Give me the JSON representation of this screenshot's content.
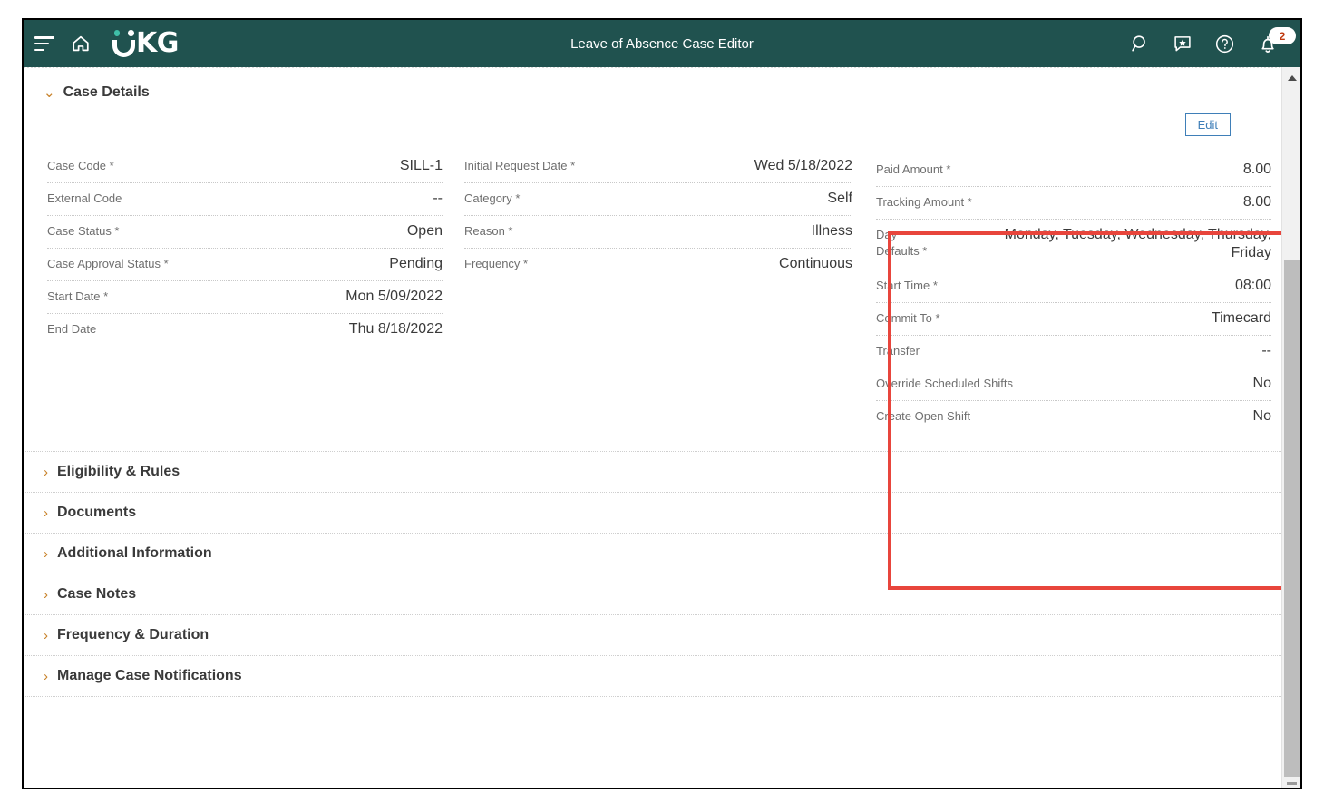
{
  "appbar": {
    "menu_label": "Main menu",
    "home_label": "Home",
    "logo_text": "KG",
    "title": "Leave of Absence Case Editor",
    "search_label": "Search",
    "feedback_label": "Feedback",
    "help_label": "Help",
    "notifications_label": "Notifications",
    "notification_count": "2",
    "bg_color": "#20524f",
    "badge_text_color": "#c0390f"
  },
  "case_details": {
    "title": "Case Details",
    "expanded_chevron": "⌄",
    "edit_label": "Edit",
    "columns": [
      {
        "fields": [
          {
            "label": "Case Code *",
            "value": "SILL-1"
          },
          {
            "label": "External Code",
            "value": "--"
          },
          {
            "label": "Case Status *",
            "value": "Open"
          },
          {
            "label": "Case Approval Status *",
            "value": "Pending"
          },
          {
            "label": "Start Date *",
            "value": "Mon 5/09/2022"
          },
          {
            "label": "End Date",
            "value": "Thu 8/18/2022"
          }
        ]
      },
      {
        "fields": [
          {
            "label": "Initial Request Date *",
            "value": "Wed 5/18/2022"
          },
          {
            "label": "Category *",
            "value": "Self"
          },
          {
            "label": "Reason *",
            "value": "Illness"
          },
          {
            "label": "Frequency *",
            "value": "Continuous"
          }
        ]
      },
      {
        "highlighted": true,
        "highlight_color": "#e8453c",
        "fields": [
          {
            "label": "Paid Amount *",
            "value": "8.00"
          },
          {
            "label": "Tracking Amount *",
            "value": "8.00"
          },
          {
            "label": "Day\nDefaults *",
            "value": "Monday, Tuesday, Wednesday, Thursday, Friday"
          },
          {
            "label": "Start Time *",
            "value": "08:00"
          },
          {
            "label": "Commit To *",
            "value": "Timecard"
          },
          {
            "label": "Transfer",
            "value": "--"
          },
          {
            "label": "Override Scheduled Shifts",
            "value": "No"
          },
          {
            "label": "Create Open Shift",
            "value": "No"
          }
        ]
      }
    ]
  },
  "accordions": [
    {
      "label": "Eligibility & Rules",
      "chevron": "›"
    },
    {
      "label": "Documents",
      "chevron": "›"
    },
    {
      "label": "Additional Information",
      "chevron": "›"
    },
    {
      "label": "Case Notes",
      "chevron": "›"
    },
    {
      "label": "Frequency & Duration",
      "chevron": "›"
    },
    {
      "label": "Manage Case Notifications",
      "chevron": "›"
    }
  ],
  "scrollbar": {
    "up_arrow_label": "Scroll up",
    "thumb_label": "Vertical scroll thumb"
  }
}
